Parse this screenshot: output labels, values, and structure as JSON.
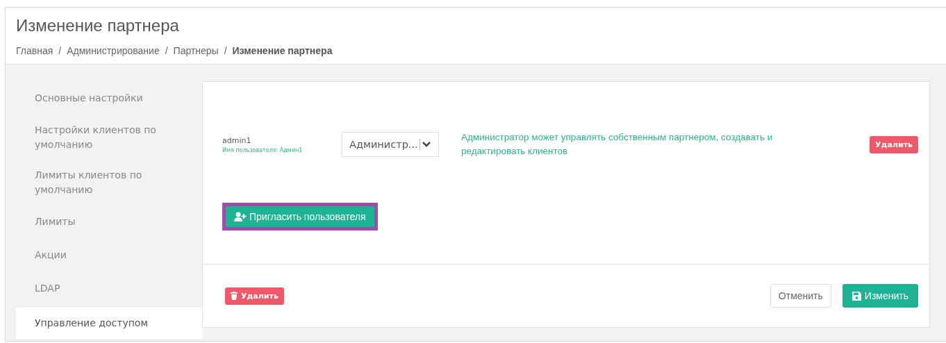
{
  "page": {
    "title": "Изменение партнера",
    "breadcrumbs": [
      {
        "label": "Главная",
        "current": false
      },
      {
        "label": "Администрирование",
        "current": false
      },
      {
        "label": "Партнеры",
        "current": false
      },
      {
        "label": "Изменение партнера",
        "current": true
      }
    ],
    "separator": "/"
  },
  "sidebar": {
    "items": [
      {
        "label": "Основные настройки",
        "selected": false
      },
      {
        "label": "Настройки клиентов по умолчанию",
        "selected": false
      },
      {
        "label": "Лимиты клиентов по умолчанию",
        "selected": false
      },
      {
        "label": "Лимиты",
        "selected": false
      },
      {
        "label": "Акции",
        "selected": false
      },
      {
        "label": "LDAP",
        "selected": false
      },
      {
        "label": "Управление доступом",
        "selected": true
      }
    ]
  },
  "users": [
    {
      "login": "admin1",
      "username": "Имя пользователя: Админ1",
      "role": "Администр...",
      "description": "Администратор может управлять собственным партнером, создавать и редактировать клиентов",
      "delete": "Удалить"
    }
  ],
  "invite_button": {
    "label": "Пригласить пользователя",
    "highlighted": true
  },
  "footer": {
    "delete": "Удалить",
    "cancel": "Отменить",
    "save": "Изменить"
  }
}
